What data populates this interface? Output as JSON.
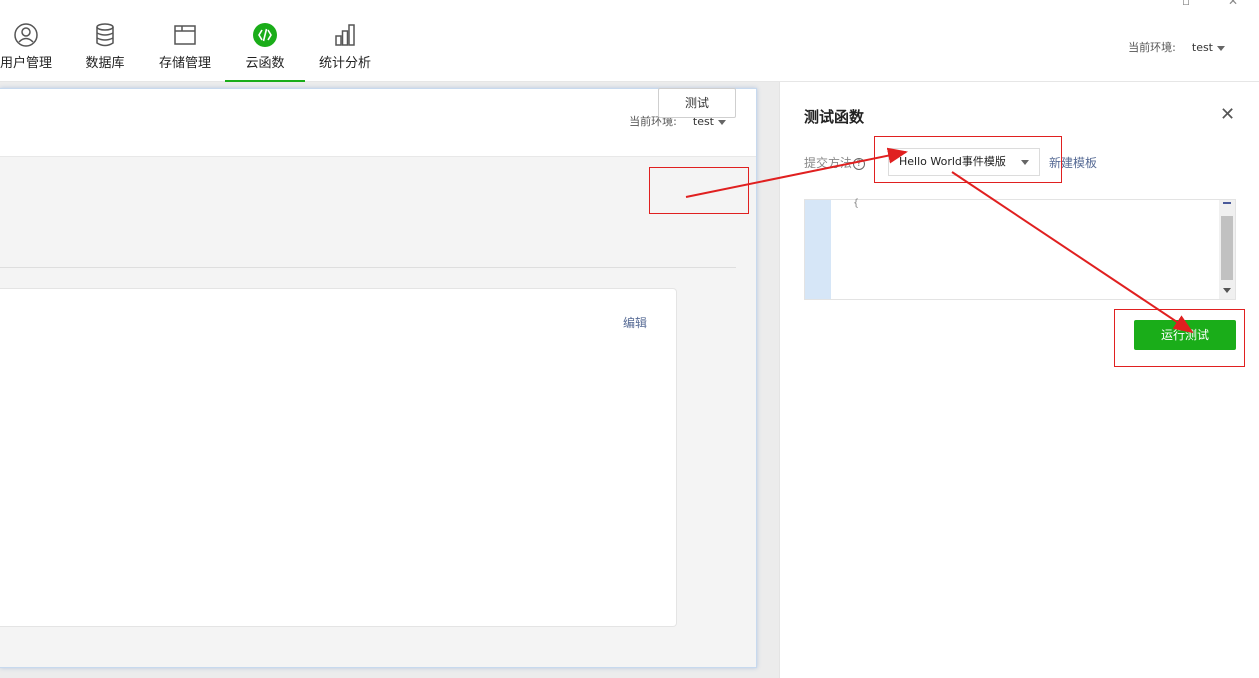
{
  "toolbar": {
    "items": [
      {
        "label": "用户管理",
        "icon": "user-icon"
      },
      {
        "label": "数据库",
        "icon": "database-icon"
      },
      {
        "label": "存储管理",
        "icon": "folder-icon"
      },
      {
        "label": "云函数",
        "icon": "cloud-function-icon",
        "active": true
      },
      {
        "label": "统计分析",
        "icon": "bar-chart-icon"
      }
    ],
    "env_label": "当前环境:",
    "env_value": "test"
  },
  "left_panel": {
    "env_label": "当前环境:",
    "env_value": "test",
    "test_button": "测试",
    "edit_link": "编辑"
  },
  "drawer": {
    "title": "测试函数",
    "close_icon": "close-icon",
    "submit_label": "提交方法",
    "help_icon": "question-circle-icon",
    "template_value": "Hello World事件模版",
    "new_template": "新建模板",
    "editor_code": "{",
    "run_button": "运行测试"
  },
  "colors": {
    "accent": "#1aad19",
    "link": "#576b95",
    "annotation": "#e02020"
  }
}
